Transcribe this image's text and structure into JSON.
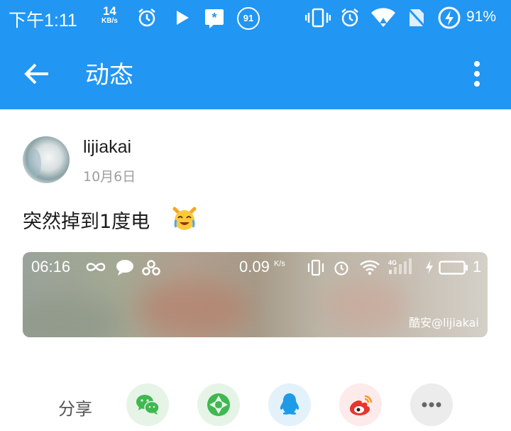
{
  "status_bar": {
    "time": "下午1:11",
    "net_speed_value": "14",
    "net_speed_unit": "KB/s",
    "notification_count": "91",
    "battery_percent": "91%"
  },
  "app_bar": {
    "title": "动态",
    "back_icon": "arrow-back-icon",
    "more_icon": "more-vert-icon"
  },
  "post": {
    "username": "lijiakai",
    "date": "10月6日",
    "text": "突然掉到1度电",
    "emoji": "crying-laughing-cat-emoji",
    "image": {
      "time": "06:16",
      "speed_value": "0.09",
      "speed_unit": "K/s",
      "network_type": "4G",
      "battery_level": "1",
      "watermark": "酷安@lijiakai"
    }
  },
  "share": {
    "label": "分享",
    "targets": [
      {
        "name": "wechat",
        "icon": "wechat-icon"
      },
      {
        "name": "moments",
        "icon": "wechat-moments-icon"
      },
      {
        "name": "qq",
        "icon": "qq-icon"
      },
      {
        "name": "weibo",
        "icon": "weibo-icon"
      },
      {
        "name": "more",
        "icon": "more-horiz-icon"
      }
    ]
  },
  "colors": {
    "primary": "#2196f3",
    "wechat_green": "#3fb850",
    "qq_blue": "#1e9be6",
    "weibo_red": "#e6352c"
  }
}
